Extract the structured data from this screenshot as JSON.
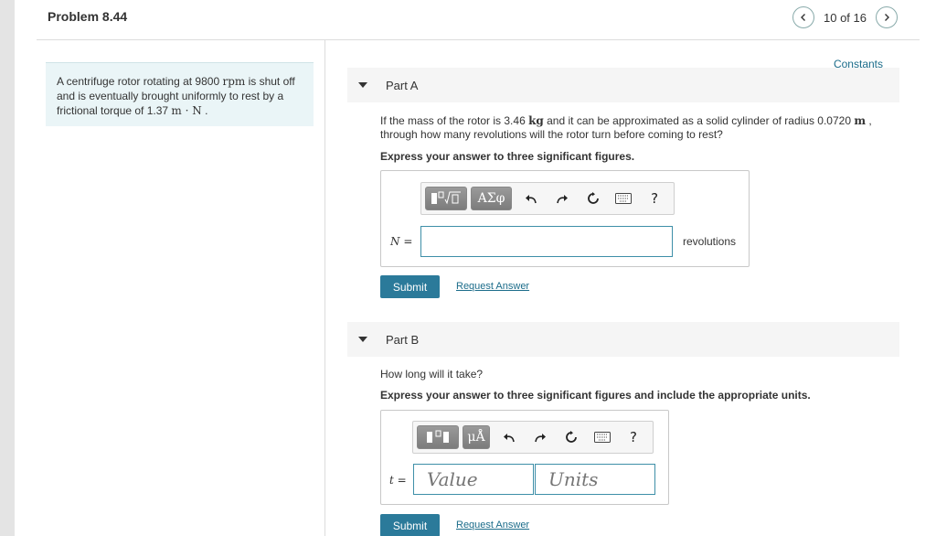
{
  "header": {
    "title": "Problem 8.44",
    "counter": "10 of 16"
  },
  "problem": {
    "text_1": "A centrifuge rotor rotating at 9800 ",
    "unit_rpm": "rpm",
    "text_2": " is shut off and is eventually brought uniformly to rest by a frictional torque of 1.37 ",
    "unit_torque": "m · N",
    "text_3": " ."
  },
  "constants_link": "Constants",
  "partA": {
    "label": "Part A",
    "question_1": "If the mass of the rotor is 3.46 ",
    "unit_kg": "kg",
    "question_2": " and it can be approximated as a solid cylinder of radius 0.0720 ",
    "unit_m": "m",
    "question_3": " , through how many revolutions will the rotor turn before coming to rest?",
    "instruction": "Express your answer to three significant figures.",
    "toolbar_greek": "ΑΣφ",
    "help": "?",
    "variable": "N",
    "equals": " =",
    "units_text": "revolutions",
    "submit": "Submit",
    "request": "Request Answer"
  },
  "partB": {
    "label": "Part B",
    "question": "How long will it take?",
    "instruction": "Express your answer to three significant figures and include the appropriate units.",
    "toolbar_units": "μÅ",
    "help": "?",
    "variable": "t",
    "equals": " =",
    "value_placeholder": "Value",
    "units_placeholder": "Units",
    "submit": "Submit",
    "request": "Request Answer"
  },
  "colors": {
    "accent": "#2b7a9a",
    "link": "#1b6c8a",
    "problem_bg": "#eaf5f7"
  }
}
